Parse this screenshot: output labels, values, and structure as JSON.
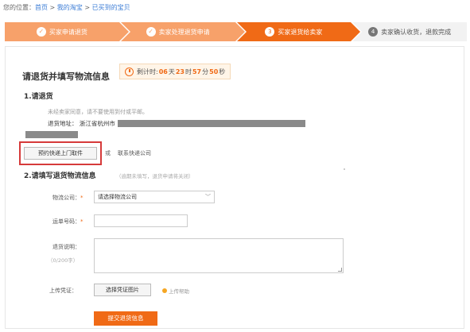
{
  "breadcrumb": {
    "prefix": "您的位置：",
    "home": "首页",
    "sep1": " > ",
    "my_taobao": "我的淘宝",
    "sep2": " > ",
    "bought": "已买到的宝贝"
  },
  "steps": [
    {
      "label": "买家申请退货",
      "state": "done"
    },
    {
      "label": "卖家处理退货申请",
      "state": "done"
    },
    {
      "label": "买家退货给卖家",
      "state": "active",
      "num": "3"
    },
    {
      "label": "卖家确认收货，退款完成",
      "state": "todo",
      "num": "4"
    }
  ],
  "title": "请退货并填写物流信息",
  "countdown": {
    "label": "剩计时:",
    "days": "06",
    "days_unit": "天",
    "hours": "23",
    "hours_unit": "时",
    "minutes": "57",
    "minutes_unit": "分",
    "seconds": "50",
    "seconds_unit": "秒"
  },
  "section1": {
    "heading": "1.请退货",
    "note": "未经卖家同意，请不要使用到付或平邮。",
    "address_label": "退货地址：",
    "address_value": "浙江省杭州市"
  },
  "reserve_button": "预约快递上门取件",
  "or_text": "或",
  "contact_text": "联系快递公司",
  "section2": {
    "heading": "2.请填写退货物流信息",
    "hint": "（逾期未填写，退货申请将关闭）"
  },
  "form": {
    "logistics_label": "物流公司：",
    "logistics_value": "请选择物流公司",
    "tracking_label": "运单号码：",
    "desc_label": "退货说明：",
    "desc_counter": "（0/200字）",
    "upload_label": "上传凭证：",
    "upload_button": "选择凭证图片",
    "upload_help": "上传帮助",
    "submit": "提交退货信息"
  },
  "colors": {
    "accent": "#f06a16",
    "step_done": "#f7a16a",
    "highlight_box": "#d63a3a"
  }
}
